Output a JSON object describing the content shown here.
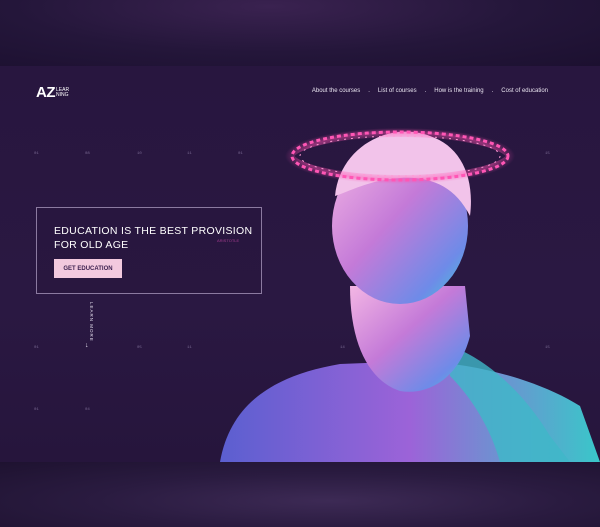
{
  "logo": {
    "main": "AZ",
    "sub_top": "LEAR",
    "sub_bottom": "NING"
  },
  "nav": [
    {
      "label": "About the courses"
    },
    {
      "label": "List of courses"
    },
    {
      "label": "How is the training"
    },
    {
      "label": "Cost of education"
    }
  ],
  "nav_separator": ".",
  "hero": {
    "title": "EDUCATION IS THE BEST PROVISION FOR OLD AGE",
    "attribution": "ARISTOTLE",
    "cta_label": "GET EDUCATION"
  },
  "learn_more": "LEARN MORE",
  "grid_numbers": {
    "row1": [
      "01",
      "08",
      "10",
      "11",
      "01",
      "15"
    ],
    "row2": [
      "01",
      "05",
      "11",
      "14",
      "15"
    ],
    "row3": [
      "01",
      "04",
      "13",
      "02"
    ]
  },
  "colors": {
    "accent": "#f2c9de",
    "halo": "#ff3fa0",
    "background": "#28163f"
  }
}
